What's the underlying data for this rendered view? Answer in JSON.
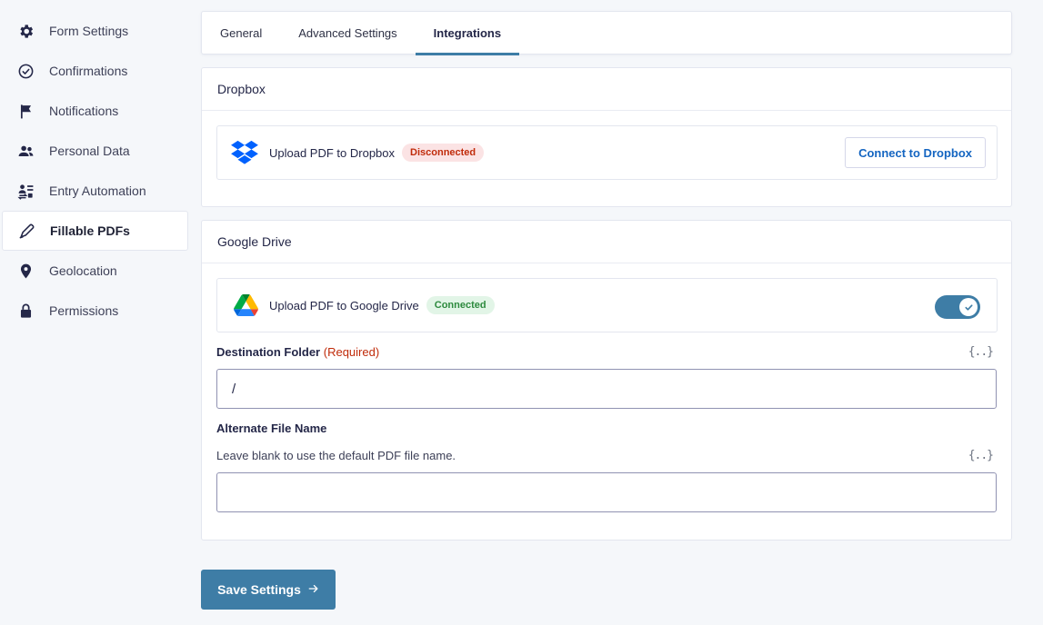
{
  "sidebar": {
    "items": [
      {
        "label": "Form Settings",
        "icon": "gear-icon"
      },
      {
        "label": "Confirmations",
        "icon": "check-circle-icon"
      },
      {
        "label": "Notifications",
        "icon": "flag-icon"
      },
      {
        "label": "Personal Data",
        "icon": "users-icon"
      },
      {
        "label": "Entry Automation",
        "icon": "automation-icon"
      },
      {
        "label": "Fillable PDFs",
        "icon": "pen-icon"
      },
      {
        "label": "Geolocation",
        "icon": "map-pin-icon"
      },
      {
        "label": "Permissions",
        "icon": "lock-icon"
      }
    ],
    "active_index": 5
  },
  "tabs": [
    {
      "label": "General"
    },
    {
      "label": "Advanced Settings"
    },
    {
      "label": "Integrations"
    }
  ],
  "dropbox": {
    "title": "Dropbox",
    "label": "Upload PDF to Dropbox",
    "status": "Disconnected",
    "connect_label": "Connect to Dropbox"
  },
  "gdrive": {
    "title": "Google Drive",
    "label": "Upload PDF to Google Drive",
    "status": "Connected",
    "enabled": true,
    "destination_label": "Destination Folder",
    "required_text": "(Required)",
    "destination_value": "/",
    "merge_tag": "{..}",
    "alt_name_label": "Alternate File Name",
    "alt_name_desc": "Leave blank to use the default PDF file name.",
    "alt_name_value": ""
  },
  "save_label": "Save Settings",
  "colors": {
    "accent": "#3e7da6",
    "link": "#1465c1",
    "error": "#c02b0a",
    "success": "#2d8a3e"
  }
}
